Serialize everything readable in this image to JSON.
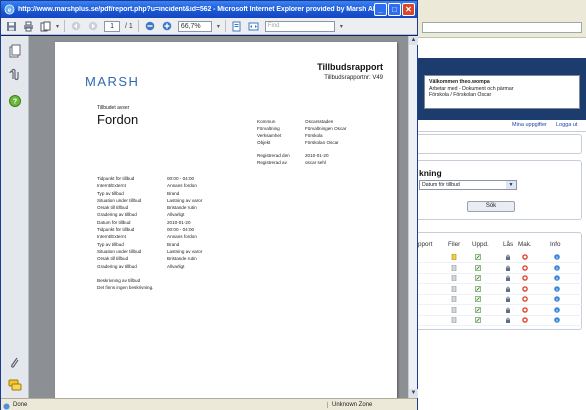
{
  "window": {
    "title": "http://www.marshplus.se/pdf/report.php?u=incident&id=562 - Microsoft Internet Explorer provided by Marsh AB",
    "buttons": [
      "_",
      "□",
      "✕"
    ]
  },
  "toolbar": {
    "current_page": "1",
    "page_total": "/ 1",
    "zoom": "66,7%",
    "find_placeholder": "Find"
  },
  "status": {
    "left": "Done",
    "zone": "Unknown Zone"
  },
  "report": {
    "title": "Tillbudsrapport",
    "number": "Tillbudsrapportnr: V49",
    "logo": "MARSH",
    "regarding_label": "Tillbudet avser",
    "regarding_value": "Fordon",
    "info": [
      {
        "k": "Kommun",
        "v": "Oscarsstaden"
      },
      {
        "k": "Förvaltning",
        "v": "Förvaltningen Oscar"
      },
      {
        "k": "Verksamhet",
        "v": "Förskola"
      },
      {
        "k": "Objekt",
        "v": "Förskolan Oscar"
      }
    ],
    "registered": [
      {
        "k": "Registrerad den",
        "v": "2010-01-20"
      },
      {
        "k": "Registrerad av",
        "v": "oscar sehl"
      }
    ],
    "details_a": [
      {
        "k": "Tidpunkt för tillbud",
        "v": "00:00 - 04:00"
      },
      {
        "k": "Internt/Externt",
        "v": "Annans fordon"
      },
      {
        "k": "Typ av tillbud",
        "v": "Brand"
      },
      {
        "k": "Situation under tillbud",
        "v": "Lastning av varor"
      },
      {
        "k": "Orsak till tillbud",
        "v": "Bristande rutin"
      },
      {
        "k": "Gradering av tillbud",
        "v": "Allvarligt"
      },
      {
        "k": "Datum för tillbud",
        "v": "2010-01-20"
      },
      {
        "k": "Tidpunkt för tillbud",
        "v": "00:00 - 04:00"
      },
      {
        "k": "Internt/Externt",
        "v": "Annans fordon"
      },
      {
        "k": "Typ av tillbud",
        "v": "Brand"
      },
      {
        "k": "Situation under tillbud",
        "v": "Lastning av varor"
      },
      {
        "k": "Orsak till tillbud",
        "v": "Bristande rutin"
      },
      {
        "k": "Gradering av tillbud",
        "v": "Allvarligt"
      }
    ],
    "description_label": "Beskrivning av tillbud",
    "description_text": "Det finns ingen beskrivning."
  },
  "background_site": {
    "welcome_title": "Välkommen theo.wompa",
    "welcome_line1": "Arbetar med - Dokument och pärmar",
    "welcome_line2": "Förskola / Förskolan Oscar",
    "link_my_tasks": "Mina uppgifter",
    "link_logout": "Logga ut",
    "sort_title": "kning",
    "sort_value": "Datum för tillbud",
    "search_button": "Sök",
    "columns": [
      "pport",
      "Filer",
      "Uppd.",
      "Lås",
      "Mak.",
      "Info"
    ],
    "row_count": 7
  },
  "colors": {
    "title_bar": "#1a58d6",
    "logo": "#2e6ab0",
    "site_header": "#1d3c6e",
    "link": "#1f46a3"
  }
}
